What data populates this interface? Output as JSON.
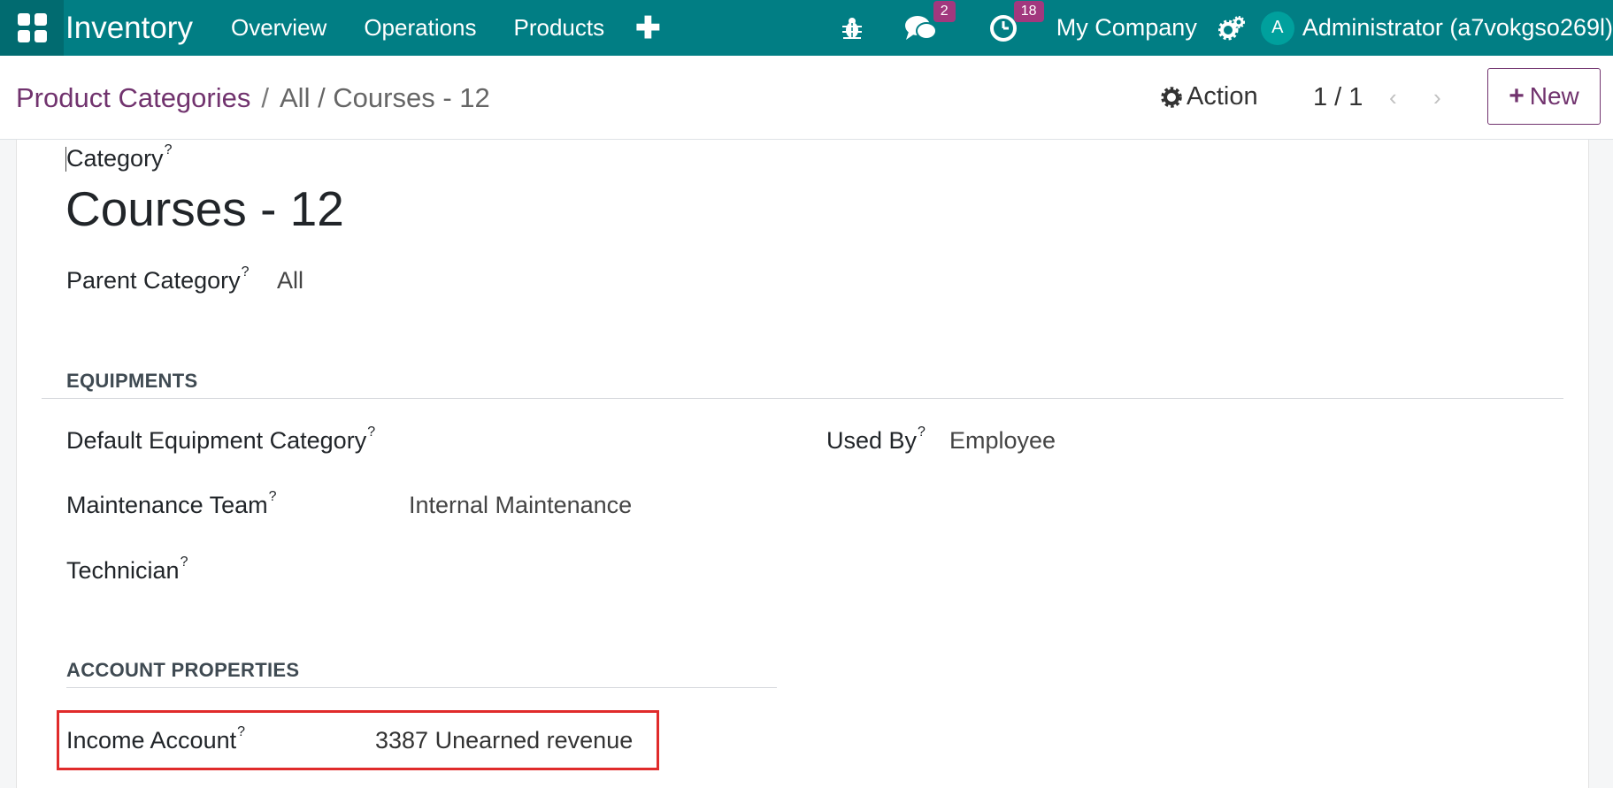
{
  "navbar": {
    "app_name": "Inventory",
    "menu": [
      "Overview",
      "Operations",
      "Products"
    ],
    "plus_symbol": "✚",
    "messages_badge": "2",
    "activities_badge": "18",
    "company": "My Company",
    "user_initial": "A",
    "user_name": "Administrator (a7vokgso269l)",
    "accent_color": "#017e84"
  },
  "breadcrumb": {
    "root": "Product Categories",
    "separator": "/",
    "current": "All / Courses - 12"
  },
  "control": {
    "action_label": "Action",
    "pager": "1 / 1",
    "prev_arrow": "‹",
    "next_arrow": "›",
    "new_label": "New"
  },
  "form": {
    "category_label": "Category",
    "help_mark": "?",
    "category_name": "Courses - 12",
    "parent_label": "Parent Category",
    "parent_value": "All",
    "equipments_section": "EQUIPMENTS",
    "default_equipment_label": "Default Equipment Category",
    "used_by_label": "Used By",
    "used_by_value": "Employee",
    "maintenance_team_label": "Maintenance Team",
    "maintenance_team_value": "Internal Maintenance",
    "technician_label": "Technician",
    "account_section": "ACCOUNT PROPERTIES",
    "income_account_label": "Income Account",
    "income_account_value": "3387 Unearned revenue"
  }
}
